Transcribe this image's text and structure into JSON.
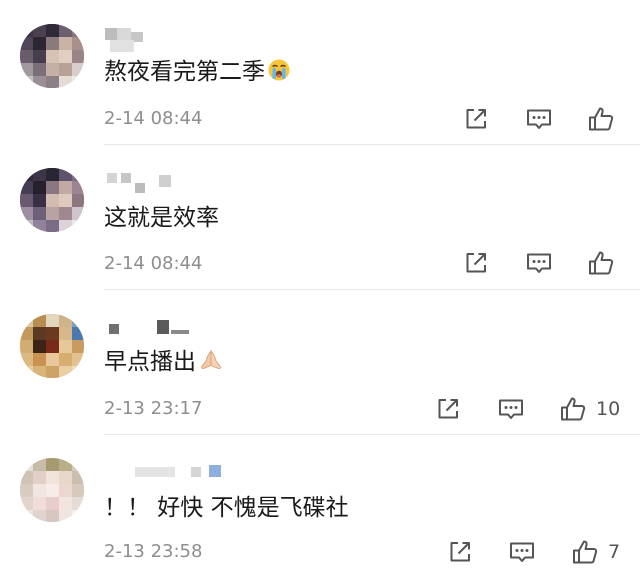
{
  "comments": [
    {
      "text": "熬夜看完第二季",
      "emoji": "loudly-crying-face",
      "time": "2-14 08:44",
      "likes": ""
    },
    {
      "text": "这就是效率",
      "emoji": "",
      "time": "2-14 08:44",
      "likes": ""
    },
    {
      "text": "早点播出",
      "emoji": "folded-hands",
      "time": "2-13 23:17",
      "likes": "10"
    },
    {
      "text": "！！ 好快 不愧是飞碟社",
      "emoji": "",
      "time": "2-13 23:58",
      "likes": "7"
    }
  ],
  "icons": {
    "share": "share-icon",
    "comment": "comment-icon",
    "like": "thumbs-up-icon"
  },
  "colors": {
    "text": "#1a1a1a",
    "meta": "#8e8e8e",
    "icon": "#555555",
    "divider": "#e8e8e8"
  }
}
